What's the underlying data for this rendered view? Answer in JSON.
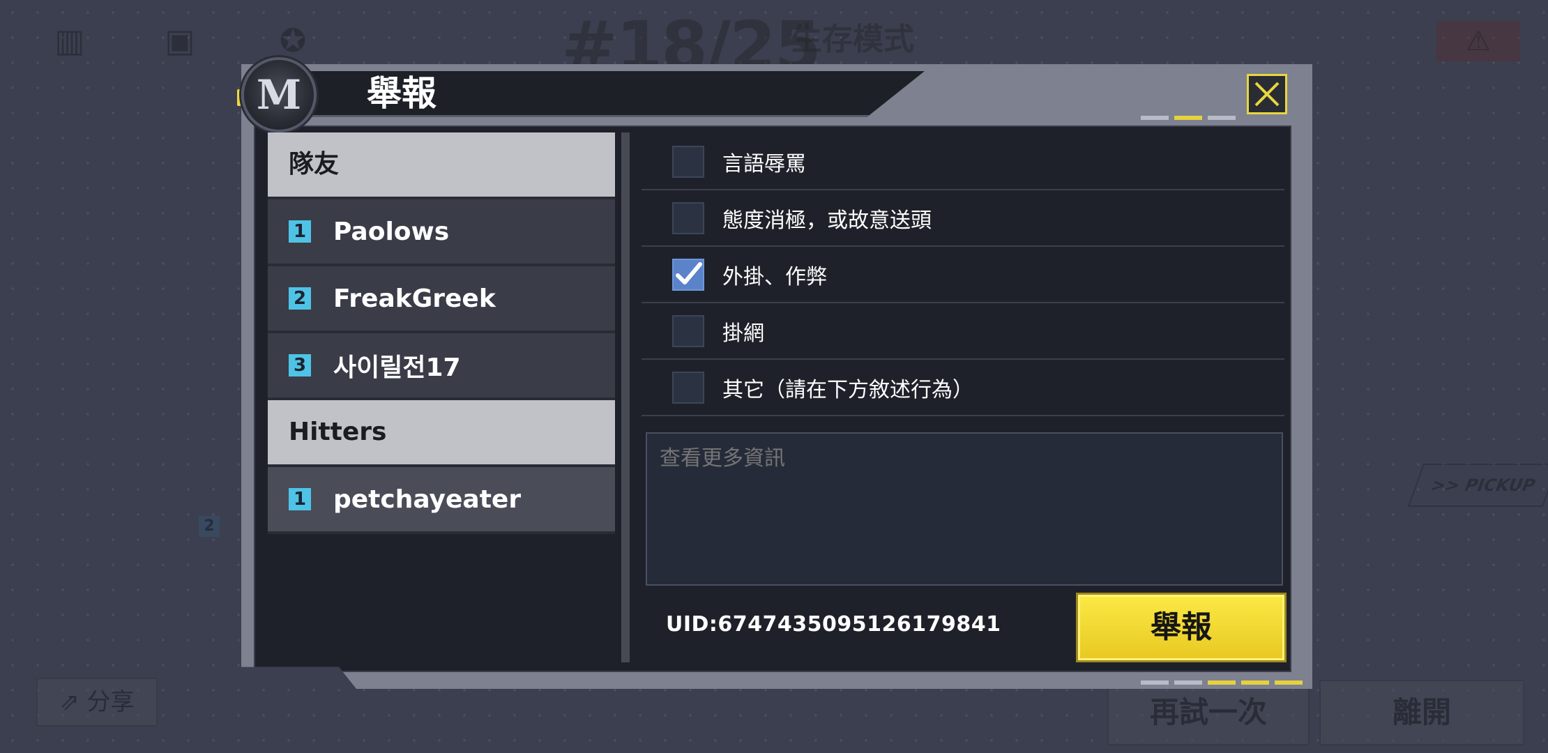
{
  "background": {
    "rank": "#18/25",
    "mode": "生存模式",
    "retry_label": "再試一次",
    "leave_label": "離開",
    "share_label": "分享",
    "pickup_label": ">> PICKUP"
  },
  "dialog": {
    "title": "舉報",
    "close_icon": "close-x-icon",
    "accent_color": "#e6d23e"
  },
  "teammates": {
    "header": "隊友",
    "players": [
      {
        "num": "1",
        "name": "Paolows"
      },
      {
        "num": "2",
        "name": "FreakGreek"
      },
      {
        "num": "3",
        "name": "사이릴전17"
      }
    ]
  },
  "hitters": {
    "header": "Hitters",
    "players": [
      {
        "num": "1",
        "name": "petchayeater"
      }
    ]
  },
  "reasons": [
    {
      "label": "言語辱罵",
      "checked": false
    },
    {
      "label": "態度消極，或故意送頭",
      "checked": false
    },
    {
      "label": "外掛、作弊",
      "checked": true
    },
    {
      "label": "掛網",
      "checked": false
    },
    {
      "label": "其它（請在下方敘述行為）",
      "checked": false
    }
  ],
  "description": {
    "placeholder": "查看更多資訊",
    "value": ""
  },
  "uid": "UID:6747435095126179841",
  "report_button_label": "舉報"
}
